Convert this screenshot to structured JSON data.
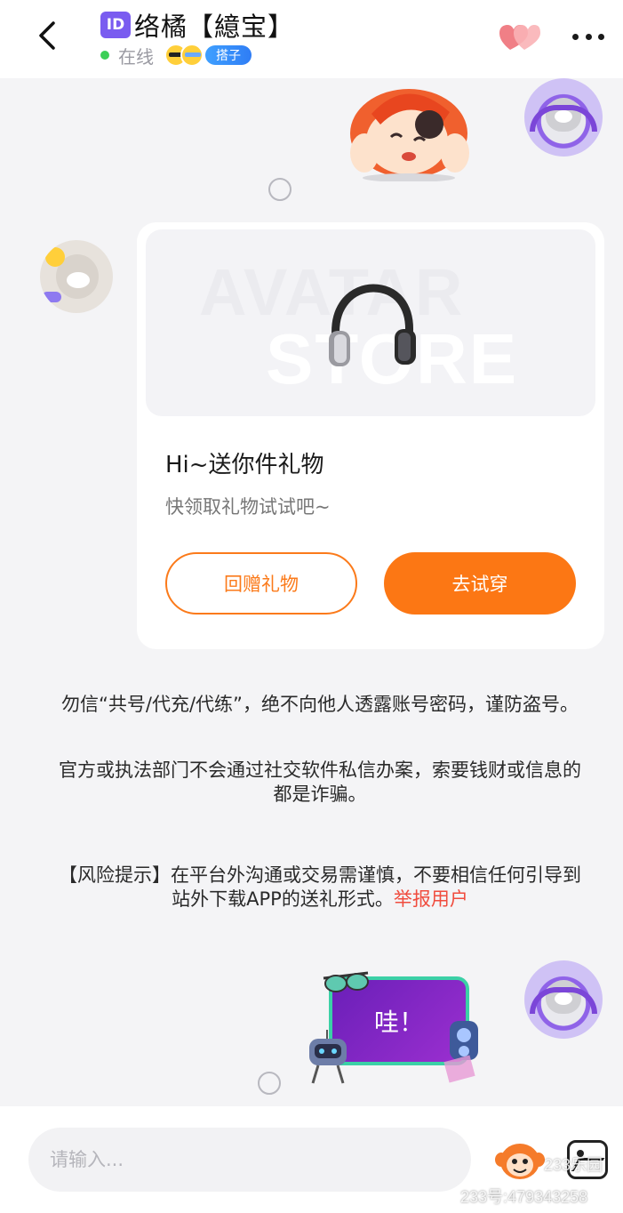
{
  "header": {
    "id_badge": "ID",
    "title": "络橘【繶宝】",
    "status": "在线",
    "tag": "搭子",
    "icons": [
      "back-arrow-icon",
      "heart-icon",
      "more-icon"
    ]
  },
  "gift_card": {
    "banner_text_1": "AVATAR",
    "banner_text_2": "STORE",
    "title": "Hi~送你件礼物",
    "subtitle": "快领取礼物试试吧~",
    "return_label": "回赠礼物",
    "try_label": "去试穿"
  },
  "notices": {
    "warning_1": "勿信“共号/代充/代练”，绝不向他人透露账号密码，谨防盗号。",
    "warning_2": "官方或执法部门不会通过社交软件私信办案，索要钱财或信息的都是诈骗。",
    "risk": "【风险提示】在平台外沟通或交易需谨慎，不要相信任何引导到站外下载APP的送礼形式。",
    "report_link": "举报用户"
  },
  "sticker_bottom": {
    "text": "哇！"
  },
  "input": {
    "placeholder": "请输入..."
  },
  "watermark": {
    "logo": "233乐园",
    "account": "233号:479343258"
  },
  "colors": {
    "accent": "#fc7714",
    "link": "#f04c3e",
    "online": "#3ccf56",
    "id_badge": "#7a5cf0"
  }
}
